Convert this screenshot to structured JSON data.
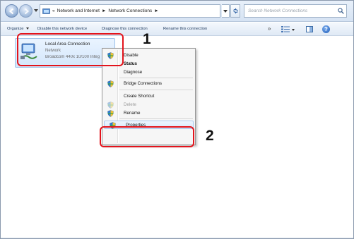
{
  "address_bar": {
    "breadcrumb_prefix": "«",
    "breadcrumb_1": "Network and Internet",
    "separator": "►",
    "breadcrumb_2": "Network Connections",
    "search_placeholder": "Search Network Connections"
  },
  "command_bar": {
    "organize": "Organize",
    "disable": "Disable this network device",
    "diagnose": "Diagnose this connection",
    "rename": "Rename this connection",
    "more": "»"
  },
  "connection": {
    "name": "Local Area Connection",
    "status": "Network",
    "device": "Broadcom 440x 10/100 Integ"
  },
  "context_menu": {
    "items": [
      {
        "label": "Disable",
        "shield": true,
        "style": "normal"
      },
      {
        "label": "Status",
        "shield": false,
        "style": "bold"
      },
      {
        "label": "Diagnose",
        "shield": false,
        "style": "normal"
      },
      {
        "label": "Bridge Connections",
        "shield": true,
        "style": "normal"
      },
      {
        "label": "Create Shortcut",
        "shield": false,
        "style": "normal"
      },
      {
        "label": "Delete",
        "shield": true,
        "style": "disabled"
      },
      {
        "label": "Rename",
        "shield": true,
        "style": "normal"
      },
      {
        "label": "Properties",
        "shield": true,
        "style": "highlighted"
      }
    ]
  },
  "annotations": {
    "step_1": "1",
    "step_2": "2",
    "color": "#e3141c"
  },
  "colors": {
    "selection_bg": "#d3e6fb",
    "toolbar_bg": "#dfe9f5"
  }
}
